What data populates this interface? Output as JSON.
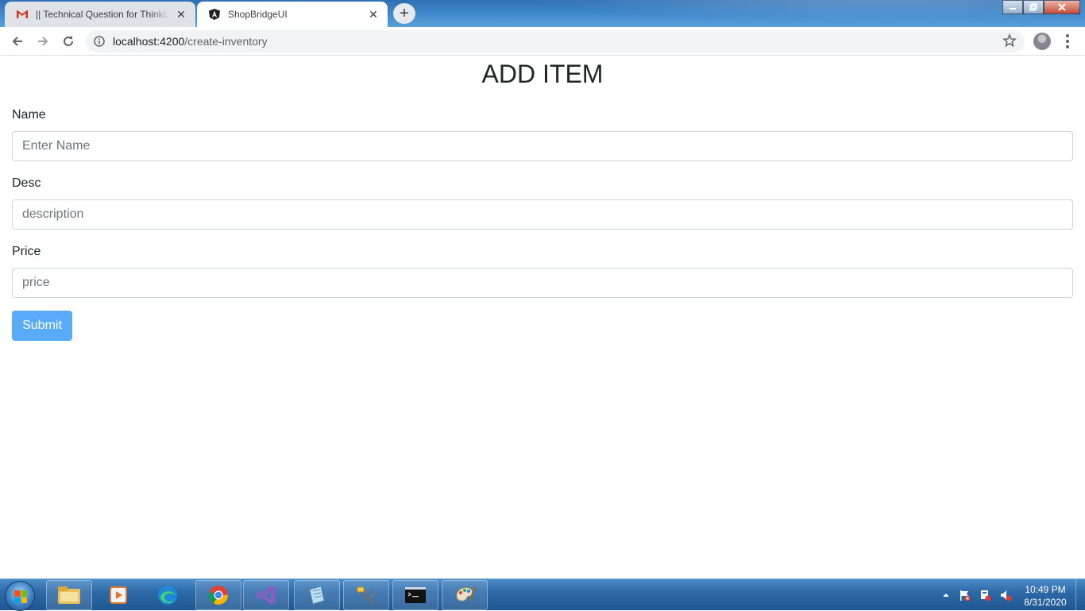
{
  "browser": {
    "tabs": [
      {
        "title": "|| Technical Question for Thinkbri",
        "icon": "gmail-icon",
        "active": false
      },
      {
        "title": "ShopBridgeUI",
        "icon": "angular-icon",
        "active": true
      }
    ],
    "close_glyph": "✕",
    "new_tab_glyph": "+",
    "url_host": "localhost:4200",
    "url_path": "/create-inventory"
  },
  "form": {
    "heading": "ADD ITEM",
    "name_label": "Name",
    "name_placeholder": "Enter Name",
    "desc_label": "Desc",
    "desc_placeholder": "description",
    "price_label": "Price",
    "price_placeholder": "price",
    "submit_label": "Submit",
    "submit_color": "#5aabf7"
  },
  "taskbar": {
    "apps": [
      "file-explorer-icon",
      "media-player-icon",
      "edge-icon",
      "chrome-icon",
      "visual-studio-icon",
      "notepad-icon",
      "tools-icon",
      "command-prompt-icon",
      "paint-icon"
    ],
    "time": "10:49 PM",
    "date": "8/31/2020"
  }
}
